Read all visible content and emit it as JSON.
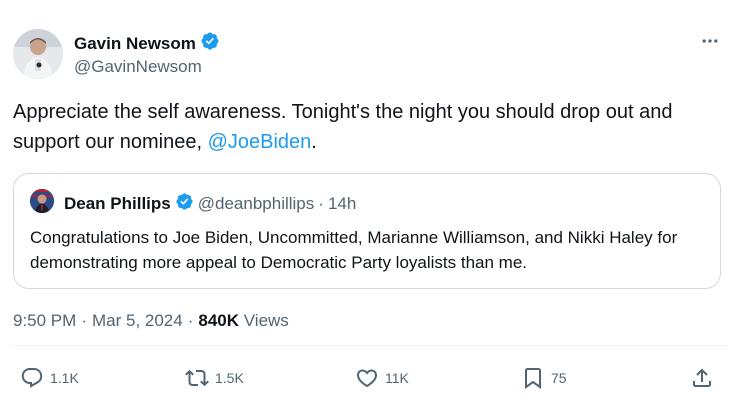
{
  "tweet": {
    "author": {
      "name": "Gavin Newsom",
      "handle": "@GavinNewsom",
      "verified_icon": "verified-badge-icon"
    },
    "more_icon": "more-icon",
    "text_before": "Appreciate the self awareness. Tonight's the night you should drop out and support our nominee, ",
    "mention": "@JoeBiden",
    "text_after": "."
  },
  "quote": {
    "name": "Dean Phillips",
    "handle": "@deanbphillips",
    "separator": "·",
    "time": "14h",
    "text": "Congratulations to Joe Biden, Uncommitted, Marianne Williamson, and Nikki Haley for demonstrating more appeal to Democratic Party loyalists than me."
  },
  "meta": {
    "time": "9:50 PM",
    "separator1": "·",
    "date": "Mar 5, 2024",
    "separator2": "·",
    "views_count": "840K",
    "views_label": "Views"
  },
  "actions": {
    "reply_count": "1.1K",
    "repost_count": "1.5K",
    "like_count": "11K",
    "bookmark_count": "75"
  },
  "colors": {
    "accent": "#1d9bf0",
    "text_primary": "#0f1419",
    "text_secondary": "#536471",
    "border": "#cfd9de"
  }
}
